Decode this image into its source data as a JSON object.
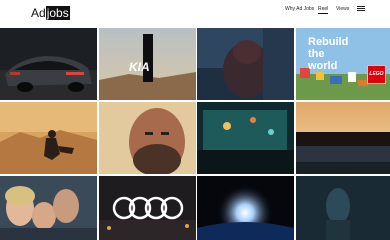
{
  "brand": {
    "name_part1": "Ad",
    "name_part2": "jobs"
  },
  "nav": {
    "items": [
      "Why Ad Jobs",
      "Reel",
      "Views"
    ],
    "active": "Reel",
    "menu_icon": "hamburger-menu-icon"
  },
  "tiles": {
    "kia_logo_text": "KIA",
    "lego_text": "LEGO",
    "rebuild_lines": [
      "Rebuild",
      "the",
      "world"
    ]
  },
  "colors": {
    "header_bg": "#ffffff",
    "text": "#111111",
    "brand_highlight": "#111111"
  }
}
